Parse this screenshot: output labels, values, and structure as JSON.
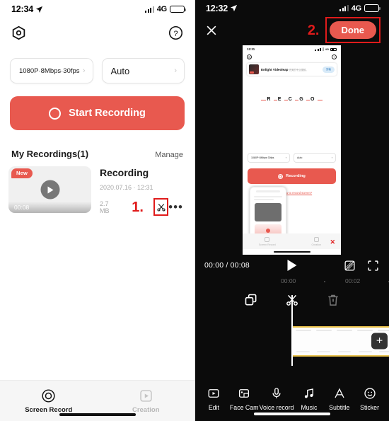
{
  "left_phone": {
    "status_bar": {
      "time": "12:34",
      "location_icon": "location-arrow-icon",
      "network": "4G"
    },
    "top_icons": {
      "settings": "hex-nut-icon",
      "help": "question-mark-icon"
    },
    "selectors": [
      {
        "label": "1080P·8Mbps·30fps",
        "chevron": "›",
        "name": "quality-selector"
      },
      {
        "label": "Auto",
        "chevron": "›",
        "name": "orientation-selector"
      }
    ],
    "record_button": {
      "label": "Start Recording",
      "color": "#e8594f"
    },
    "recordings": {
      "section_title": "My Recordings(1)",
      "manage_label": "Manage",
      "item": {
        "badge": "New",
        "duration": "00:08",
        "name": "Recording",
        "date": "2020.07.16 · 12:31",
        "size": "2.7 MB",
        "step_marker": "1.",
        "cut_icon": "scissors-icon",
        "more_icon": "ellipsis-icon"
      }
    },
    "tabs": [
      {
        "label": "Screen Record",
        "icon": "record-circle-icon",
        "active": true
      },
      {
        "label": "Creation",
        "icon": "video-play-square-icon",
        "active": false
      }
    ]
  },
  "right_phone": {
    "status_bar": {
      "time": "12:32",
      "location_icon": "location-arrow-icon",
      "network": "4G"
    },
    "close_icon": "close-x-icon",
    "step_marker": "2.",
    "done_button": {
      "label": "Done",
      "color": "#e8594f"
    },
    "preview": {
      "status_time": "12:31",
      "network": "4G",
      "ad": {
        "title": "Enlight Videoleap",
        "subtitle": "完美的专业视频。",
        "button": "安装",
        "tag": "广告"
      },
      "brand": "RECGO",
      "brand_letters": [
        "R",
        "E",
        "C",
        "G",
        "O"
      ],
      "selectors": [
        {
          "label": "1080P·8Mbps·30fps",
          "chevron": "›"
        },
        {
          "label": "Auto",
          "chevron": "›"
        }
      ],
      "record_label": "Recording",
      "howto": "How to record screen?",
      "tabs": [
        "Screen Record",
        "Creation"
      ],
      "close_marker": "✕"
    },
    "playback": {
      "current_time": "00:00",
      "total_time": "00:08",
      "time_display": "00:00 / 00:08",
      "play_icon": "play-triangle-icon",
      "ratio_icon": "aspect-ratio-icon",
      "collapse_icon": "collapse-arrows-icon"
    },
    "ruler": {
      "ticks": [
        "00:00",
        "00:02"
      ]
    },
    "edit_tools": [
      {
        "name": "copy-tool",
        "icon": "copy-squares-icon"
      },
      {
        "name": "split-tool",
        "icon": "scissors-icon"
      },
      {
        "name": "delete-tool",
        "icon": "trash-icon"
      }
    ],
    "timeline": {
      "add_clip_label": "+",
      "clip_border_color": "#e8c14a"
    },
    "bottom_tools": [
      {
        "label": "Edit",
        "icon": "edit-video-icon"
      },
      {
        "label": "Face Cam",
        "icon": "face-cam-icon"
      },
      {
        "label": "Voice record",
        "icon": "microphone-icon"
      },
      {
        "label": "Music",
        "icon": "music-note-icon"
      },
      {
        "label": "Subtitle",
        "icon": "letter-a-icon"
      },
      {
        "label": "Sticker",
        "icon": "smiley-icon"
      }
    ]
  }
}
